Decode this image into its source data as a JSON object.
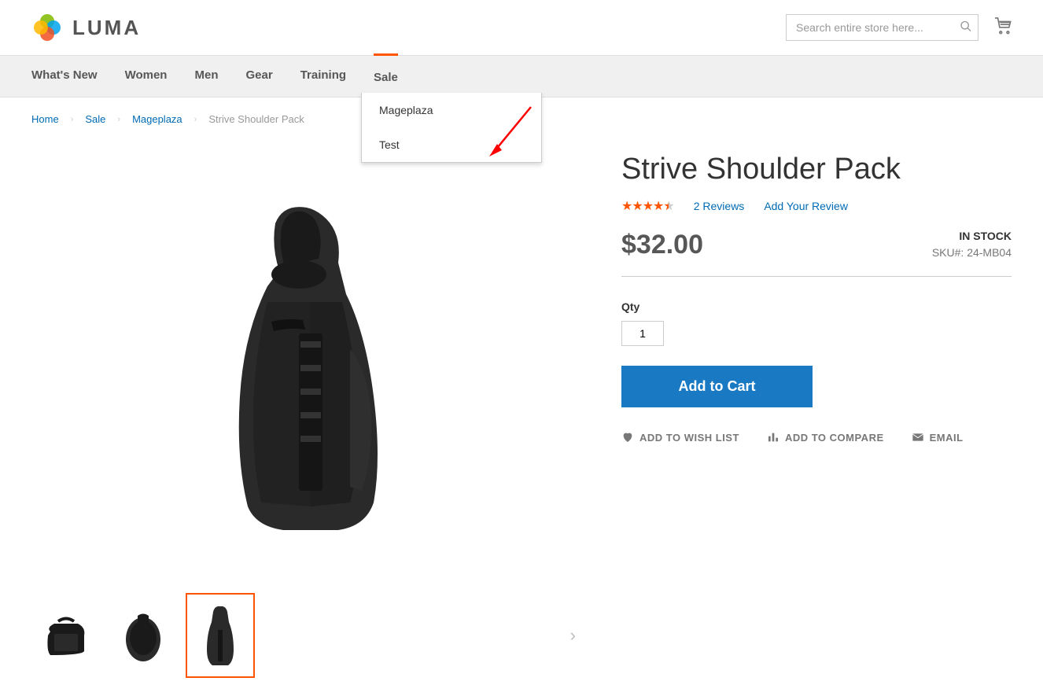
{
  "header": {
    "logo_text": "LUMA",
    "search_placeholder": "Search entire store here..."
  },
  "nav": {
    "items": [
      "What's New",
      "Women",
      "Men",
      "Gear",
      "Training",
      "Sale"
    ],
    "dropdown": [
      "Mageplaza",
      "Test"
    ]
  },
  "breadcrumbs": {
    "items": [
      "Home",
      "Sale",
      "Mageplaza",
      "Strive Shoulder Pack"
    ]
  },
  "product": {
    "title": "Strive Shoulder Pack",
    "reviews_text": "2 Reviews",
    "add_review_text": "Add Your Review",
    "price": "$32.00",
    "stock_status": "IN STOCK",
    "sku_label": "SKU#:",
    "sku_value": "24-MB04",
    "qty_label": "Qty",
    "qty_value": "1",
    "add_to_cart": "Add to Cart",
    "wishlist": "ADD TO WISH LIST",
    "compare": "ADD TO COMPARE",
    "email": "EMAIL"
  }
}
